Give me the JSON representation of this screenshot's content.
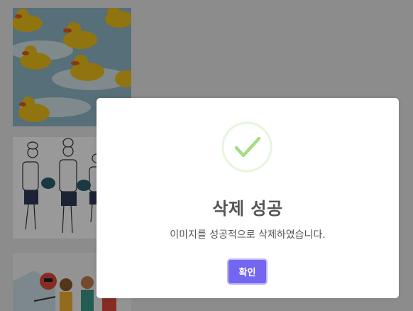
{
  "gallery": {
    "images": [
      {
        "icon": "rubber-ducks-image"
      },
      {
        "icon": "chefs-illustration-image"
      },
      {
        "icon": "people-illustration-image"
      }
    ]
  },
  "dialog": {
    "icon": "success-check-icon",
    "title": "삭제 성공",
    "text": "이미지를 성공적으로 삭제하였습니다.",
    "confirm_label": "확인",
    "colors": {
      "confirm": "#7367f0",
      "check": "#a5dc86"
    }
  }
}
